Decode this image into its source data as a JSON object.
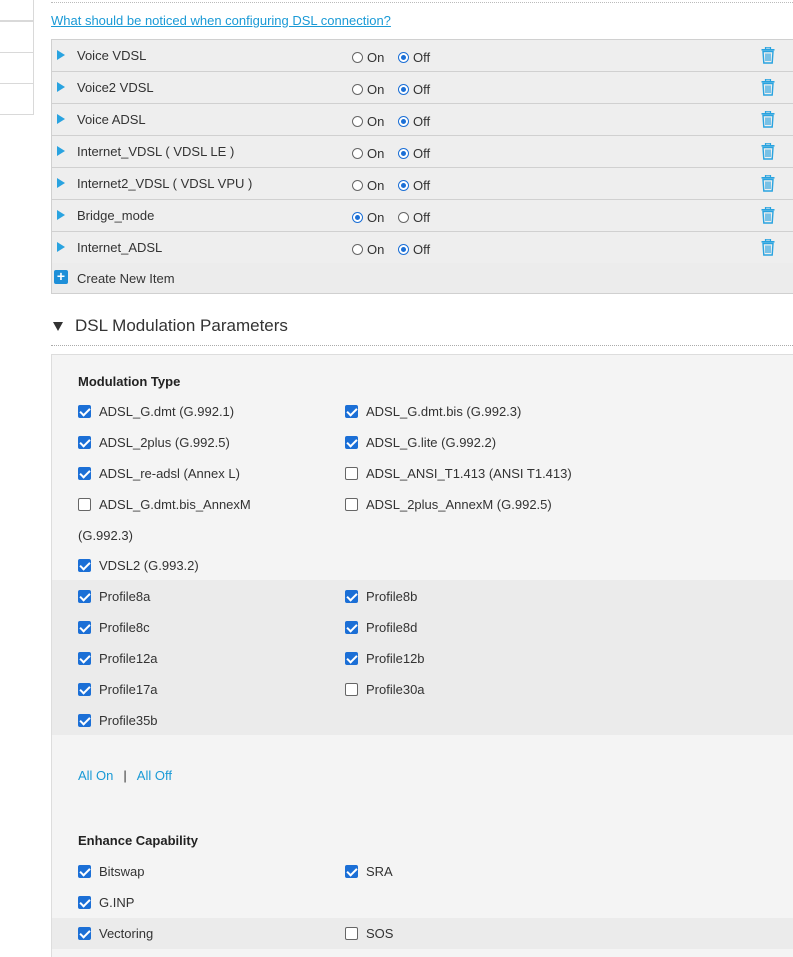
{
  "help_link": "What should be noticed when configuring DSL connection?",
  "connections": [
    {
      "name": "Voice VDSL",
      "state": "off"
    },
    {
      "name": "Voice2 VDSL",
      "state": "off"
    },
    {
      "name": "Voice ADSL",
      "state": "off"
    },
    {
      "name": "Internet_VDSL ( VDSL LE )",
      "state": "off"
    },
    {
      "name": "Internet2_VDSL ( VDSL VPU )",
      "state": "off"
    },
    {
      "name": "Bridge_mode",
      "state": "on"
    },
    {
      "name": "Internet_ADSL",
      "state": "off"
    }
  ],
  "radio_labels": {
    "on": "On",
    "off": "Off"
  },
  "create_new": "Create New Item",
  "section_title": "DSL Modulation Parameters",
  "modulation": {
    "title": "Modulation Type",
    "items": [
      {
        "label": "ADSL_G.dmt (G.992.1)",
        "checked": true
      },
      {
        "label": "ADSL_G.dmt.bis (G.992.3)",
        "checked": true
      },
      {
        "label": "ADSL_2plus (G.992.5)",
        "checked": true
      },
      {
        "label": "ADSL_G.lite (G.992.2)",
        "checked": true
      },
      {
        "label": "ADSL_re-adsl (Annex L)",
        "checked": true
      },
      {
        "label": "ADSL_ANSI_T1.413 (ANSI T1.413)",
        "checked": false
      },
      {
        "label": "ADSL_G.dmt.bis_AnnexM",
        "checked": false
      },
      {
        "label": "ADSL_2plus_AnnexM (G.992.5)",
        "checked": false
      },
      {
        "label": "VDSL2 (G.993.2)",
        "checked": true
      }
    ],
    "wrap_text": "(G.992.3)"
  },
  "profiles": [
    {
      "label": "Profile8a",
      "checked": true
    },
    {
      "label": "Profile8b",
      "checked": true
    },
    {
      "label": "Profile8c",
      "checked": true
    },
    {
      "label": "Profile8d",
      "checked": true
    },
    {
      "label": "Profile12a",
      "checked": true
    },
    {
      "label": "Profile12b",
      "checked": true
    },
    {
      "label": "Profile17a",
      "checked": true
    },
    {
      "label": "Profile30a",
      "checked": false
    },
    {
      "label": "Profile35b",
      "checked": true
    }
  ],
  "all_on": "All On",
  "separator": "|",
  "all_off": "All Off",
  "enhance": {
    "title": "Enhance Capability",
    "items": [
      {
        "label": "Bitswap",
        "checked": true
      },
      {
        "label": "SRA",
        "checked": true
      },
      {
        "label": "G.INP",
        "checked": true
      },
      {
        "label": "Vectoring",
        "checked": true
      },
      {
        "label": "SOS",
        "checked": false
      }
    ]
  },
  "colors": {
    "accent": "#1a9ad6",
    "checkbox": "#1b6fd6",
    "row_bg": "#eeeeee"
  },
  "icons": {
    "expand": "triangle-right-icon",
    "delete": "trash-icon",
    "add": "plus-icon",
    "collapse": "triangle-down-icon"
  }
}
